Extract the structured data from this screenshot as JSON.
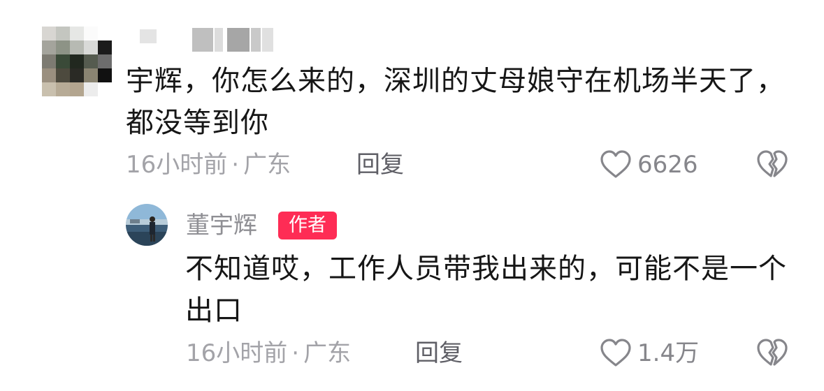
{
  "comments": [
    {
      "text": "宇辉，你怎么来的，深圳的丈母娘守在机场半天了，都没等到你",
      "time": "16小时前",
      "separator": "·",
      "location": "广东",
      "reply_label": "回复",
      "like_count": "6626"
    }
  ],
  "replies": [
    {
      "author": "董宇辉",
      "badge": "作者",
      "text": "不知道哎，工作人员带我出来的，可能不是一个出口",
      "time": "16小时前",
      "separator": "·",
      "location": "广东",
      "reply_label": "回复",
      "like_count": "1.4万"
    }
  ],
  "icons": {
    "like": "heart-icon",
    "dislike": "broken-heart-icon"
  },
  "colors": {
    "badge": "#fe2c55",
    "meta_text": "#a3a3a8",
    "primary_text": "#161616"
  }
}
